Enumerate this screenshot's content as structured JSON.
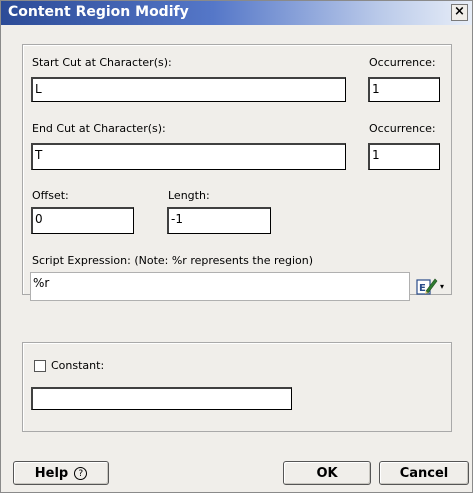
{
  "window": {
    "title": "Content Region Modify",
    "close_glyph": "×"
  },
  "cut": {
    "start_label": "Start Cut at Character(s):",
    "start_value": "L",
    "start_occurrence_label": "Occurrence:",
    "start_occurrence_value": "1",
    "end_label": "End Cut at Character(s):",
    "end_value": "T",
    "end_occurrence_label": "Occurrence:",
    "end_occurrence_value": "1",
    "offset_label": "Offset:",
    "offset_value": "0",
    "length_label": "Length:",
    "length_value": "-1",
    "script_label": "Script Expression: (Note: %r represents the region)",
    "script_value": "%r",
    "script_icon": "edit-expression-icon",
    "dropdown_glyph": "▾"
  },
  "constant": {
    "label": "Constant:",
    "value": ""
  },
  "buttons": {
    "help": "Help",
    "help_glyph": "?",
    "ok": "OK",
    "cancel": "Cancel"
  }
}
